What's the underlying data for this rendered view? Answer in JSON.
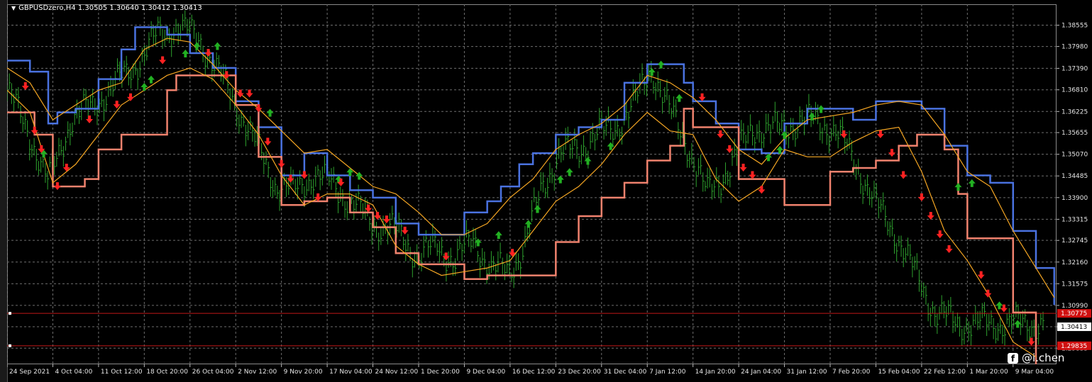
{
  "window": {
    "symbol_line": "GBPUSDzero,H4  1.30505 1.30640 1.30412 1.30413"
  },
  "watermark": {
    "icon": "facebook-icon",
    "icon_glyph": "f",
    "text": "@i.chen"
  },
  "colors": {
    "background": "#000000",
    "grid": "#6e6e6e",
    "bull_bar": "#2ea12e",
    "upper_band": "#4a72e0",
    "lower_band": "#f0826e",
    "inner_bands": "#f5a623",
    "buy_arrow": "#22b022",
    "sell_arrow": "#ff2222",
    "hline": "#c01818",
    "price_label_bg": "#d01010"
  },
  "chart_data": {
    "type": "line",
    "ylim": [
      1.294,
      1.3912
    ],
    "grid": true,
    "price_ticks": [
      "1.38555",
      "1.37980",
      "1.37390",
      "1.36810",
      "1.36225",
      "1.35655",
      "1.35070",
      "1.34485",
      "1.33900",
      "1.33315",
      "1.32745",
      "1.32160",
      "1.31575",
      "1.30990",
      "1.30413",
      "1.29835"
    ],
    "price_tick_values": [
      1.38555,
      1.3798,
      1.3739,
      1.3681,
      1.36225,
      1.35655,
      1.3507,
      1.34485,
      1.339,
      1.33315,
      1.32745,
      1.3216,
      1.31575,
      1.3099,
      1.30413,
      1.29835
    ],
    "current_price_label": "1.30413",
    "hline_labels": [
      "1.30775",
      "1.29835"
    ],
    "hline_values": [
      1.30775,
      1.299
    ],
    "time_labels": [
      "24 Sep 2021",
      "4 Oct 04:00",
      "11 Oct 12:00",
      "18 Oct 20:00",
      "26 Oct 04:00",
      "2 Nov 12:00",
      "9 Nov 20:00",
      "17 Nov 04:00",
      "24 Nov 12:00",
      "1 Dec 20:00",
      "9 Dec 04:00",
      "16 Dec 12:00",
      "23 Dec 20:00",
      "31 Dec 04:00",
      "7 Jan 12:00",
      "14 Jan 20:00",
      "24 Jan 04:00",
      "31 Jan 12:00",
      "7 Feb 20:00",
      "15 Feb 04:00",
      "22 Feb 12:00",
      "1 Mar 20:00",
      "9 Mar 04:00"
    ],
    "x": [
      0,
      2,
      4,
      6,
      8,
      10,
      12,
      14,
      16,
      18,
      20,
      22,
      24,
      26,
      28,
      30,
      32,
      34,
      36,
      38,
      40,
      42,
      44
    ],
    "xlim": [
      0,
      45.9
    ],
    "close": [
      1.368,
      1.356,
      1.343,
      1.36,
      1.364,
      1.37,
      1.376,
      1.383,
      1.385,
      1.382,
      1.371,
      1.362,
      1.352,
      1.342,
      1.341,
      1.345,
      1.343,
      1.338,
      1.332,
      1.33,
      1.323,
      1.326,
      1.322,
      1.328,
      1.319,
      1.32,
      1.325,
      1.342,
      1.351,
      1.352,
      1.356,
      1.358,
      1.364,
      1.374,
      1.362,
      1.353,
      1.34,
      1.347,
      1.358,
      1.357,
      1.359,
      1.36,
      1.357,
      1.35,
      1.337,
      1.33,
      1.32,
      1.308,
      1.305,
      1.305
    ],
    "close_x": [
      0,
      1,
      1.8,
      2.8,
      3.8,
      4.8,
      5.8,
      6.6,
      7.4,
      8.4,
      9.4,
      10.2,
      11,
      11.8,
      12.6,
      13.4,
      14.2,
      15,
      16,
      17,
      18,
      18.8,
      19.6,
      20.4,
      21.2,
      22,
      22.6,
      23.4,
      24.2,
      25,
      25.8,
      26.6,
      27.4,
      28.2,
      29,
      29.8,
      30.6,
      31.6,
      32.6,
      33.4,
      34.4,
      35.4,
      36.2,
      37,
      38,
      38.8,
      39.6,
      40.6,
      41.6,
      42.4
    ],
    "series": [
      {
        "name": "",
        "role": "upper_band",
        "x": [
          0,
          1,
          1.8,
          2.2,
          3,
          4,
          5,
          5.6,
          6,
          7,
          8,
          9,
          10,
          11,
          12,
          13,
          13.4,
          14,
          15,
          16,
          17,
          18,
          19,
          20,
          21,
          21.6,
          22.4,
          23,
          24,
          25,
          26,
          27,
          28,
          28.8,
          29.6,
          30,
          31,
          32,
          33,
          34,
          35,
          36,
          37,
          38,
          38.6,
          39,
          40,
          41,
          42,
          43,
          44,
          45,
          45.8
        ],
        "y": [
          1.376,
          1.373,
          1.359,
          1.362,
          1.363,
          1.371,
          1.379,
          1.385,
          1.385,
          1.383,
          1.378,
          1.374,
          1.365,
          1.358,
          1.345,
          1.351,
          1.351,
          1.345,
          1.341,
          1.339,
          1.332,
          1.329,
          1.329,
          1.335,
          1.338,
          1.342,
          1.348,
          1.351,
          1.356,
          1.358,
          1.36,
          1.37,
          1.375,
          1.375,
          1.37,
          1.365,
          1.359,
          1.352,
          1.351,
          1.359,
          1.363,
          1.363,
          1.36,
          1.365,
          1.365,
          1.365,
          1.363,
          1.353,
          1.345,
          1.343,
          1.33,
          1.32,
          1.31
        ]
      },
      {
        "name": "",
        "role": "lower_band",
        "x": [
          0,
          1,
          1.2,
          2,
          3,
          3.4,
          4,
          5,
          6,
          7,
          7.4,
          8,
          9,
          10,
          11,
          12,
          13,
          14,
          15,
          16,
          16.6,
          17,
          18,
          19,
          20,
          21,
          22,
          23,
          24,
          25,
          26,
          27,
          28,
          29,
          29.6,
          30,
          31,
          32,
          33,
          34,
          35,
          36,
          37,
          38,
          39,
          39.8,
          40,
          41,
          41.6,
          42,
          43,
          44,
          45
        ],
        "y": [
          1.362,
          1.362,
          1.356,
          1.342,
          1.342,
          1.344,
          1.352,
          1.356,
          1.356,
          1.368,
          1.372,
          1.372,
          1.372,
          1.364,
          1.35,
          1.337,
          1.338,
          1.339,
          1.335,
          1.331,
          1.331,
          1.324,
          1.321,
          1.321,
          1.317,
          1.318,
          1.318,
          1.318,
          1.327,
          1.334,
          1.339,
          1.343,
          1.349,
          1.353,
          1.363,
          1.358,
          1.358,
          1.344,
          1.344,
          1.337,
          1.337,
          1.346,
          1.347,
          1.349,
          1.353,
          1.356,
          1.356,
          1.352,
          1.34,
          1.328,
          1.328,
          1.308,
          1.294
        ]
      },
      {
        "name": "",
        "role": "inner_upper",
        "x": [
          0,
          1,
          2,
          3,
          4,
          5,
          6,
          7,
          8,
          9,
          10,
          11,
          12,
          13,
          14,
          15,
          16,
          17,
          18,
          19,
          20,
          21,
          22,
          23,
          24,
          25,
          26,
          27,
          28,
          29,
          30,
          31,
          32,
          33,
          34,
          35,
          36,
          37,
          38,
          39,
          40,
          41,
          42,
          43,
          44,
          45,
          45.8
        ],
        "y": [
          1.374,
          1.37,
          1.36,
          1.364,
          1.368,
          1.37,
          1.379,
          1.382,
          1.381,
          1.375,
          1.368,
          1.363,
          1.357,
          1.351,
          1.352,
          1.347,
          1.342,
          1.34,
          1.335,
          1.329,
          1.329,
          1.332,
          1.339,
          1.344,
          1.352,
          1.356,
          1.359,
          1.364,
          1.372,
          1.37,
          1.366,
          1.36,
          1.352,
          1.348,
          1.355,
          1.36,
          1.361,
          1.362,
          1.364,
          1.365,
          1.364,
          1.356,
          1.346,
          1.342,
          1.33,
          1.32,
          1.312
        ]
      },
      {
        "name": "",
        "role": "inner_lower",
        "x": [
          0,
          1,
          2,
          3,
          4,
          5,
          6,
          7,
          8,
          9,
          10,
          11,
          12,
          13,
          14,
          15,
          16,
          17,
          18,
          19,
          20,
          21,
          22,
          23,
          24,
          25,
          26,
          27,
          28,
          29,
          30,
          31,
          32,
          33,
          34,
          35,
          36,
          37,
          38,
          39,
          40,
          41,
          42,
          43,
          44,
          45
        ],
        "y": [
          1.368,
          1.362,
          1.343,
          1.348,
          1.356,
          1.364,
          1.368,
          1.372,
          1.374,
          1.371,
          1.364,
          1.356,
          1.345,
          1.337,
          1.34,
          1.34,
          1.337,
          1.326,
          1.321,
          1.318,
          1.319,
          1.32,
          1.322,
          1.33,
          1.338,
          1.342,
          1.348,
          1.356,
          1.362,
          1.357,
          1.356,
          1.344,
          1.338,
          1.342,
          1.352,
          1.35,
          1.35,
          1.354,
          1.357,
          1.358,
          1.346,
          1.33,
          1.322,
          1.312,
          1.3,
          1.296
        ]
      }
    ],
    "buy_arrows_x": [
      1.6,
      6,
      6.3,
      7.8,
      8.3,
      9.2,
      11.5,
      14.5,
      15,
      15.4,
      20.6,
      21.5,
      22.8,
      23.2,
      24.2,
      24.6,
      25.4,
      26.4,
      28.2,
      28.6,
      29.4,
      33.3,
      33.8,
      34,
      35.2,
      35.6,
      41.6,
      42.2,
      43.4,
      44.2
    ],
    "buy_arrows_y": [
      1.351,
      1.369,
      1.371,
      1.378,
      1.38,
      1.38,
      1.362,
      1.344,
      1.346,
      1.345,
      1.327,
      1.329,
      1.332,
      1.336,
      1.344,
      1.346,
      1.349,
      1.353,
      1.373,
      1.375,
      1.366,
      1.35,
      1.352,
      1.356,
      1.361,
      1.363,
      1.342,
      1.343,
      1.31,
      1.305
    ],
    "sell_arrows_x": [
      0.8,
      1.2,
      1.5,
      2.2,
      2.6,
      3.6,
      4.8,
      5.4,
      6.8,
      8.8,
      9.6,
      10.2,
      10.6,
      11,
      11.4,
      12,
      12.4,
      13,
      13.6,
      14.6,
      15.8,
      16.2,
      16.6,
      17.4,
      19.2,
      22.1,
      30.4,
      31.2,
      31.6,
      32.2,
      32.6,
      33,
      36.6,
      38.2,
      38.7,
      39.2,
      40,
      40.4,
      40.8,
      41.2,
      42.6,
      42.9,
      43.6,
      44.8
    ],
    "sell_arrows_y": [
      1.369,
      1.357,
      1.352,
      1.342,
      1.347,
      1.36,
      1.364,
      1.366,
      1.376,
      1.378,
      1.372,
      1.367,
      1.367,
      1.363,
      1.354,
      1.348,
      1.344,
      1.345,
      1.339,
      1.343,
      1.336,
      1.334,
      1.333,
      1.33,
      1.323,
      1.324,
      1.366,
      1.356,
      1.352,
      1.347,
      1.345,
      1.341,
      1.356,
      1.356,
      1.351,
      1.345,
      1.339,
      1.334,
      1.329,
      1.325,
      1.318,
      1.313,
      1.309,
      1.3
    ]
  }
}
